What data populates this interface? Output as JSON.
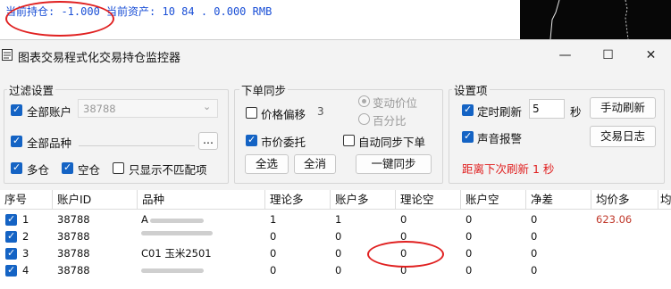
{
  "background_app": {
    "status_text": "当前持仓: -1.000  当前资产: 10  84  .      0.000 RMB"
  },
  "window": {
    "title": "图表交易程式化交易持仓监控器",
    "controls": {
      "minimize": "—",
      "maximize": "☐",
      "close": "✕"
    }
  },
  "filter": {
    "title": "过滤设置",
    "all_accounts_label": "全部账户",
    "all_accounts_checked": true,
    "account_value": "38788",
    "all_products_label": "全部品种",
    "all_products_checked": true,
    "products_value": "",
    "browse_label": "...",
    "long_label": "多仓",
    "long_checked": true,
    "short_label": "空仓",
    "short_checked": true,
    "mismatch_only_label": "只显示不匹配项",
    "mismatch_only_checked": false
  },
  "order_sync": {
    "title": "下单同步",
    "price_offset_label": "价格偏移",
    "price_offset_checked": false,
    "price_offset_value": "3",
    "variable_price_label": "变动价位",
    "percent_label": "百分比",
    "market_order_label": "市价委托",
    "market_order_checked": true,
    "auto_sync_label": "自动同步下单",
    "auto_sync_checked": false,
    "select_all_label": "全选",
    "clear_all_label": "全消",
    "one_key_sync_label": "一键同步"
  },
  "settings": {
    "title": "设置项",
    "timed_refresh_label": "定时刷新",
    "timed_refresh_checked": true,
    "refresh_seconds": "5",
    "seconds_unit": "秒",
    "manual_refresh_label": "手动刷新",
    "sound_alarm_label": "声音报警",
    "sound_alarm_checked": true,
    "trade_log_label": "交易日志",
    "countdown_text": "距离下次刷新 1 秒"
  },
  "table": {
    "headers": [
      "序号",
      "账户ID",
      "品种",
      "理论多",
      "账户多",
      "理论空",
      "账户空",
      "净差",
      "均价多",
      "均"
    ],
    "rows": [
      {
        "checked": true,
        "index": "1",
        "account": "38788",
        "product": "A",
        "theory_long": "1",
        "account_long": "1",
        "theory_short": "0",
        "account_short": "0",
        "net_diff": "0",
        "avg_long": "623.06"
      },
      {
        "checked": true,
        "index": "2",
        "account": "38788",
        "product": "",
        "theory_long": "0",
        "account_long": "0",
        "theory_short": "0",
        "account_short": "0",
        "net_diff": "0",
        "avg_long": ""
      },
      {
        "checked": true,
        "index": "3",
        "account": "38788",
        "product": "C01 玉米2501",
        "theory_long": "0",
        "account_long": "0",
        "theory_short": "0",
        "account_short": "0",
        "net_diff": "0",
        "avg_long": ""
      },
      {
        "checked": true,
        "index": "4",
        "account": "38788",
        "product": "",
        "theory_long": "0",
        "account_long": "0",
        "theory_short": "0",
        "account_short": "0",
        "net_diff": "0",
        "avg_long": ""
      }
    ]
  },
  "colors": {
    "accent": "#1463c4",
    "countdown": "#e02020",
    "avg_long": "#c0392b",
    "status_text": "#1a4fd6"
  }
}
